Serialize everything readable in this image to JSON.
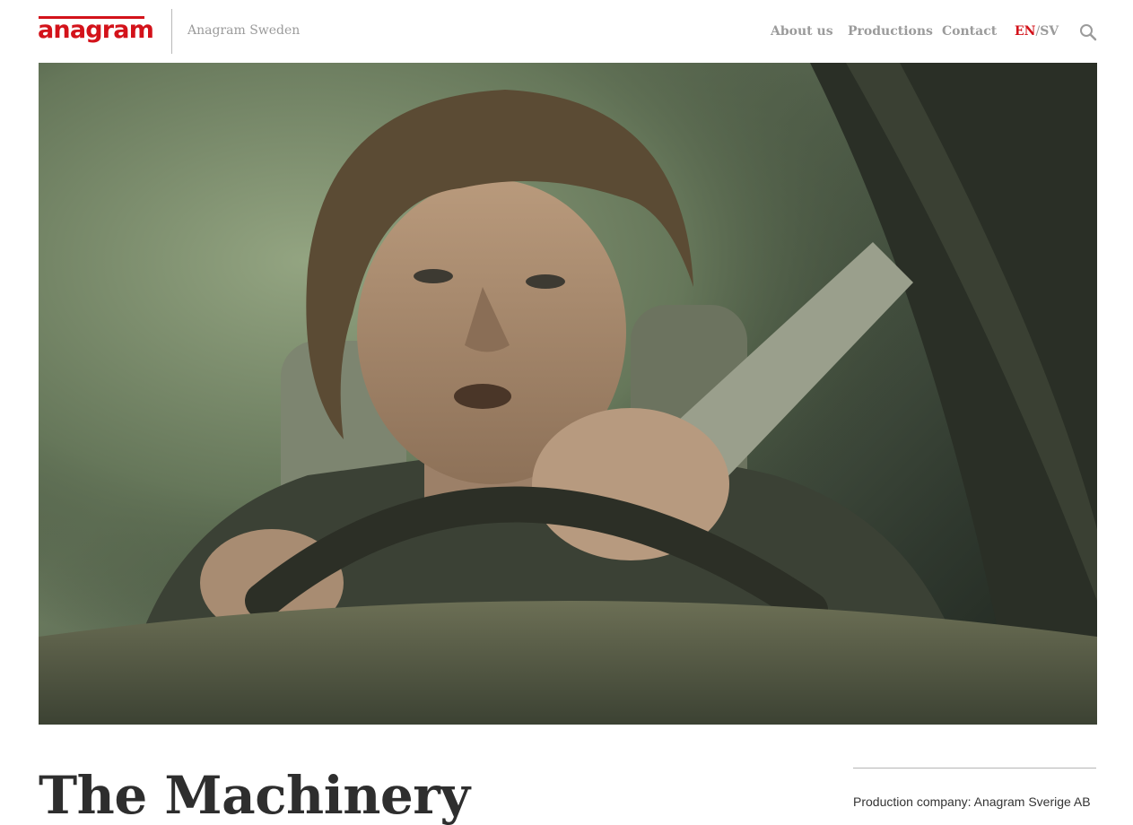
{
  "header": {
    "logo_text": "anagram",
    "subtitle": "Anagram Sweden",
    "nav": {
      "about": "About us",
      "productions": "Productions",
      "contact": "Contact"
    },
    "language": {
      "active": "EN",
      "separator": "/",
      "other": "SV"
    },
    "search_icon": "search-icon"
  },
  "hero": {
    "image": "film-still"
  },
  "production": {
    "title": "The Machinery",
    "info_line": "Production company: Anagram Sverige AB"
  },
  "colors": {
    "brand_red": "#d3121a",
    "nav_gray": "#9b9b9b",
    "title": "#2e2e2e"
  }
}
